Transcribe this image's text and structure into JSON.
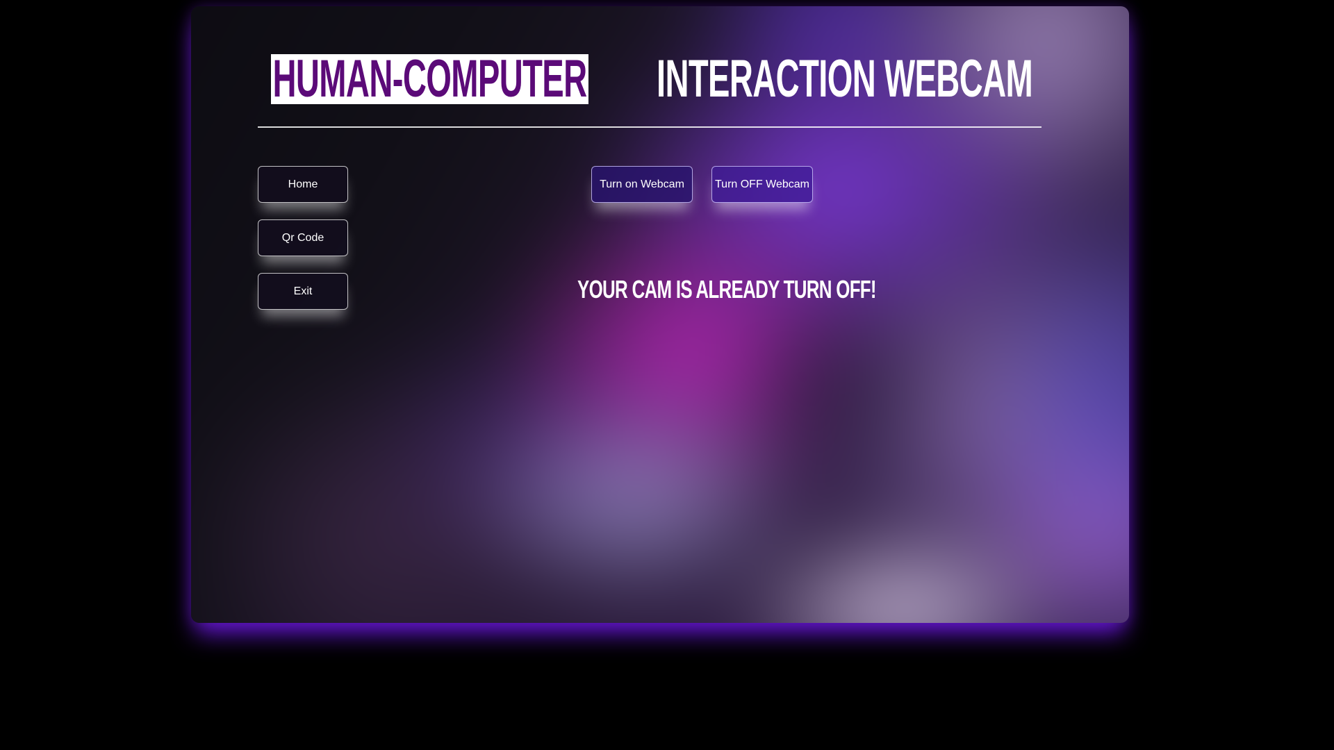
{
  "header": {
    "title_highlight": "HUMAN-COMPUTER",
    "title_rest": "INTERACTION WEBCAM"
  },
  "sidebar": {
    "items": [
      {
        "label": "Home"
      },
      {
        "label": "Qr Code"
      },
      {
        "label": "Exit"
      }
    ]
  },
  "webcam_controls": {
    "turn_on_label": "Turn on Webcam",
    "turn_off_label": "Turn OFF Webcam"
  },
  "status": {
    "message": "Your cam is already turn off!"
  },
  "colors": {
    "page_background": "#000000",
    "title_highlight_text": "#5b0a78",
    "title_highlight_background": "#ffffff",
    "glow_accent": "#6e19e6"
  }
}
